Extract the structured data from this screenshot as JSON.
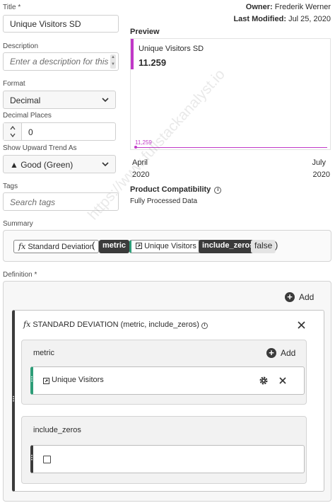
{
  "header": {
    "owner_label": "Owner:",
    "owner_value": "Frederik Werner",
    "modified_label": "Last Modified:",
    "modified_value": "Jul 25, 2020"
  },
  "title": {
    "label": "Title",
    "required_mark": "*",
    "value": "Unique Visitors SD"
  },
  "description": {
    "label": "Description",
    "placeholder": "Enter a description for this"
  },
  "format": {
    "label": "Format",
    "value": "Decimal"
  },
  "decimal_places": {
    "label": "Decimal Places",
    "value": "0"
  },
  "upward_trend": {
    "label": "Show Upward Trend As",
    "value": "▲ Good (Green)"
  },
  "tags": {
    "label": "Tags",
    "placeholder": "Search tags"
  },
  "preview": {
    "label": "Preview",
    "metric_name": "Unique Visitors SD",
    "metric_value": "11.259",
    "line_value_label": "11,259",
    "start_month": "April",
    "start_year": "2020",
    "end_month": "July",
    "end_year": "2020",
    "accent_color": "#c038c7"
  },
  "compatibility": {
    "label": "Product Compatibility",
    "value": "Fully Processed Data"
  },
  "summary": {
    "label": "Summary",
    "fx_symbol": "fx",
    "function_name": "Standard Deviation",
    "open_paren": "(",
    "param1": "metric",
    "metric_name": "Unique Visitors",
    "param2": "include_zeros",
    "param2_value": "false",
    "close_paren": ")"
  },
  "definition": {
    "label": "Definition",
    "required_mark": "*",
    "add_label": "Add",
    "function_title": "STANDARD DEVIATION (metric, include_zeros)",
    "fx_symbol": "fx",
    "metric_section": {
      "label": "metric",
      "add_label": "Add",
      "metric_name": "Unique Visitors"
    },
    "zeros_section": {
      "label": "include_zeros",
      "checked": false
    }
  },
  "watermark": "https://www.fullstackanalyst.io"
}
